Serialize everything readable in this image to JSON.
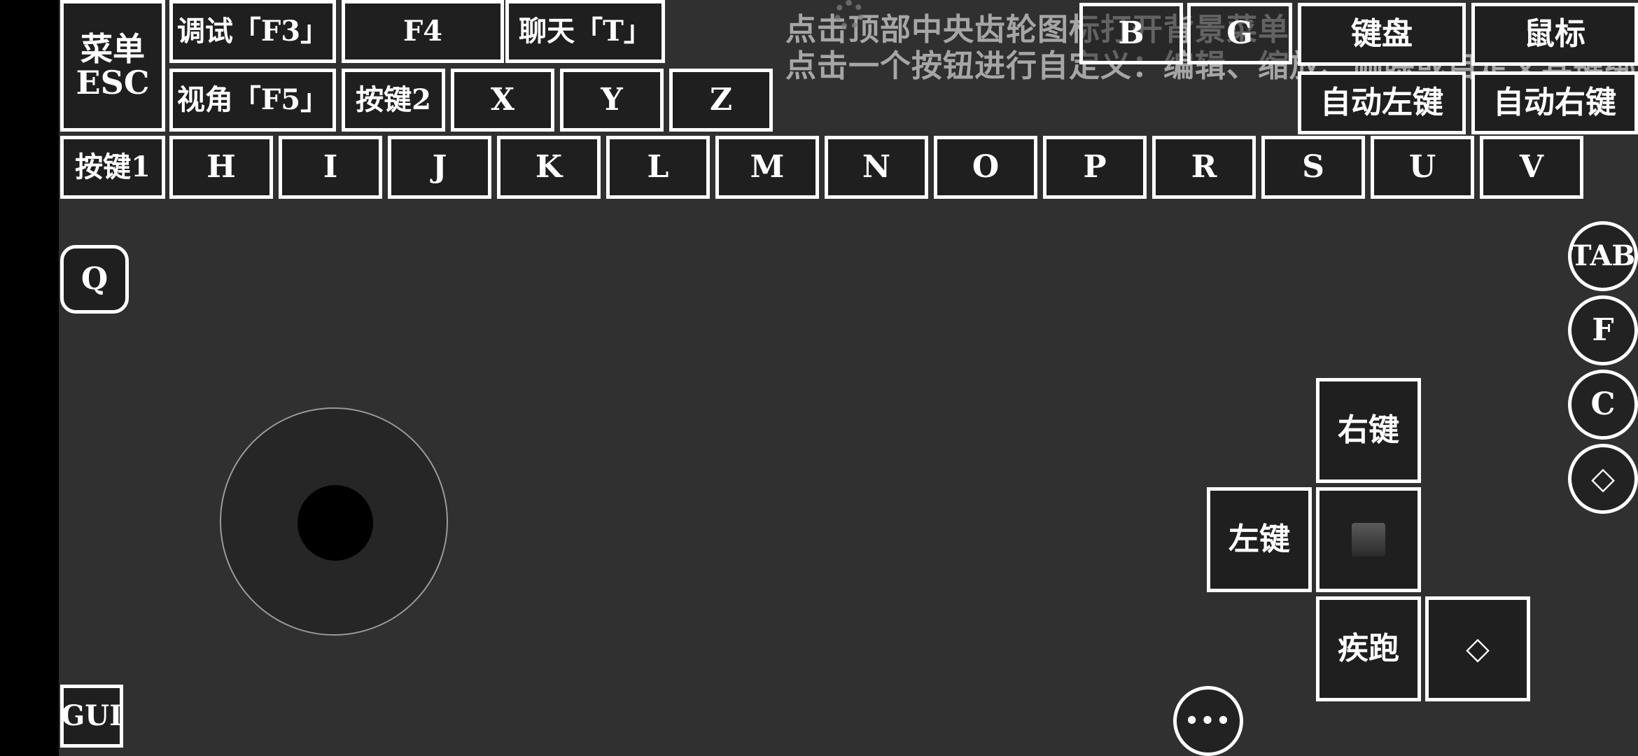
{
  "top_row1": {
    "menu_esc": "菜单\nESC",
    "debug_f3": "调试「F3」",
    "f4": "F4",
    "chat_t": "聊天「T」",
    "b": "B",
    "g": "G",
    "keyboard": "键盘",
    "mouse": "鼠标"
  },
  "top_row2": {
    "view_f5": "视角「F5」",
    "key2": "按键2",
    "x": "X",
    "y": "Y",
    "z": "Z",
    "auto_left_click": "自动左键",
    "auto_right_click": "自动右键"
  },
  "letter_row": {
    "key1": "按键1",
    "keys": [
      "H",
      "I",
      "J",
      "K",
      "L",
      "M",
      "N",
      "O",
      "P",
      "R",
      "S",
      "U",
      "V"
    ]
  },
  "hint": {
    "line1": "点击顶部中央齿轮图标打开背景菜单",
    "line2": "点击一个按钮进行自定义：编辑、缩放、删除或自定义其键绑定。"
  },
  "left_controls": {
    "q": "Q",
    "gui": "GUI"
  },
  "right_column": {
    "tab": "TAB",
    "f": "F",
    "c": "C",
    "diamond": "◇"
  },
  "mouse_pad": {
    "right_click": "右键",
    "left_click": "左键",
    "sprint": "疾跑",
    "diamond": "◇"
  },
  "more_button": "•••",
  "icons": [
    "gear-icon",
    "diamond-icon",
    "square-icon",
    "more-icon"
  ],
  "colors": {
    "background": "#303030",
    "button_border": "#ffffff",
    "side_bar": "#000000"
  }
}
